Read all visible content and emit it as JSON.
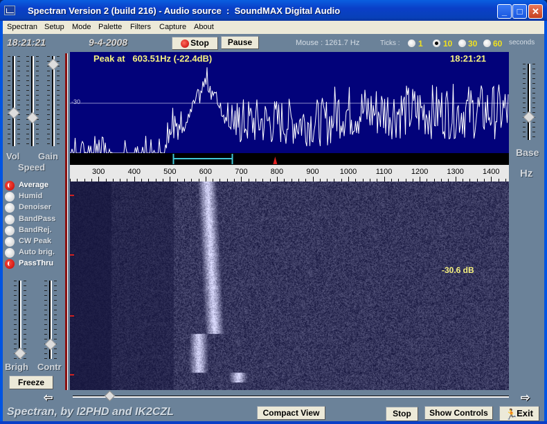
{
  "window": {
    "title": "Spectran Version 2 (build 216) - Audio source  :  SoundMAX Digital Audio",
    "controls": {
      "minimize": "_",
      "maximize": "□",
      "close": "✕"
    }
  },
  "menu": [
    "Spectran",
    "Setup",
    "Mode",
    "Palette",
    "Filters",
    "Capture",
    "About"
  ],
  "header": {
    "time": "18:21:21",
    "date": "9-4-2008",
    "stop_label": "Stop",
    "pause_label": "Pause",
    "mouse_readout": "Mouse :  1261.7 Hz",
    "ticks_label": "Ticks :",
    "tick_options": [
      {
        "label": "1",
        "selected": false
      },
      {
        "label": "10",
        "selected": true
      },
      {
        "label": "30",
        "selected": false
      },
      {
        "label": "60",
        "selected": false
      }
    ],
    "seconds_label": "seconds"
  },
  "left_panel": {
    "sliders_top": [
      {
        "name": "vol",
        "level": 0.64
      },
      {
        "name": "speed",
        "level": 0.7
      },
      {
        "name": "gain",
        "level": 0.05
      }
    ],
    "labels": {
      "vol": "Vol",
      "gain": "Gain",
      "speed": "Speed"
    },
    "options": [
      {
        "label": "Average",
        "on": true
      },
      {
        "label": "Humid",
        "on": false
      },
      {
        "label": "Denoiser",
        "on": false
      },
      {
        "label": "BandPass",
        "on": false
      },
      {
        "label": "BandRej.",
        "on": false
      },
      {
        "label": "CW Peak",
        "on": false
      },
      {
        "label": "Auto brig.",
        "on": false
      },
      {
        "label": "PassThru",
        "on": true
      }
    ],
    "sliders_bottom": [
      {
        "name": "brigh",
        "level": 0.98
      },
      {
        "name": "contr",
        "level": 0.85
      }
    ],
    "bottom_labels": {
      "brigh": "Brigh",
      "contr": "Contr"
    },
    "freeze_label": "Freeze"
  },
  "spectrum": {
    "peak_text": "Peak at   603.51Hz (-22.4dB)",
    "time": "18:21:21",
    "db_reference": "-30",
    "peak_hz": 603.51,
    "peak_db": -22.4,
    "filter_band_hz": [
      510,
      675
    ],
    "marker_hz": 795
  },
  "freq_scale": {
    "min_hz": 220,
    "max_hz": 1450,
    "labels": [
      "300",
      "400",
      "500",
      "600",
      "700",
      "800",
      "900",
      "1000",
      "1100",
      "1200",
      "1300",
      "1400"
    ]
  },
  "waterfall": {
    "level_readout": "-30.6 dB"
  },
  "right_panel": {
    "base_level": 0.72,
    "base_label": "Base",
    "hz_label": "Hz"
  },
  "scroll": {
    "position": 0.08
  },
  "footer": {
    "credit": "Spectran, by I2PHD and IK2CZL",
    "compact_view_label": "Compact View",
    "stop_label": "Stop",
    "show_controls_label": "Show Controls",
    "exit_label": "Exit"
  }
}
